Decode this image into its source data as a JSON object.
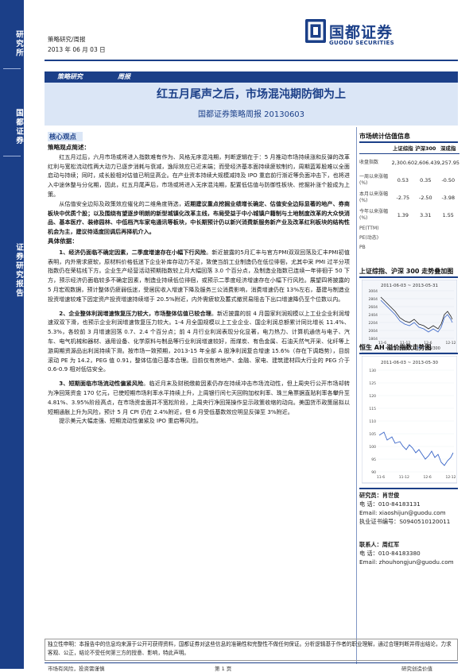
{
  "sidebar": {
    "labels": [
      "研究所",
      "国都证券",
      "证券研究报告"
    ]
  },
  "header": {
    "category": "策略研究/周报",
    "date": "2013 年 06 月 03 日",
    "logo_cn": "国都证券",
    "logo_en": "GUODU SECURITIES"
  },
  "tags": {
    "left": "策略研究",
    "right": "周报"
  },
  "title": "红五月尾声之后，市场混沌期防御为上",
  "subtitle": "国都证券策略周报 20130603",
  "core_label": "核心观点",
  "summary_heading": "策略观点简述：",
  "summary_para1": "红五月过后，六月市场或将进入指数难有作为、风格无序混沌期，判断逻辑在于：5 月推动市场持续涨和反弹的改革红利与宽松流动性两大动力已逐步消耗与衰减，逸际效应已近末端；而受经济基本面持续疲软制约，周期蓝筹股难以全面启动与持续；同时，成长股相对估值已明显高企。在产业资本持续大规模减持及 IPO 重启前行渐近等负面冲击下，也将进入中途休整与分化期，因此，红五月尾声后，市场或将进入无序混沌期，配置低估值与防御性板块、挖掘补涨个股成为上策。",
  "summary_para2": "从估值安全边际及政策效应催化的二维角度筛选，",
  "summary_para2_bold": "近期建议重点挖掘业绩增长确定、估值安全边际显著的地产、券商板块中优质个股；以及围绕有望逐步明朗的新型城镇化改革主线，布局受益于中小城镇户籍制与土地制度改革的大众快消品、基本医疗、装修园林、中低档汽车家电通讯等板块，中长期预计仍以新兴消费新服务新产业及改革红利板块的结构性机会为主，建议待适度回调后再择机介入。",
  "detail_heading": "具体依据：",
  "point1_bold": "1、经济仍面临不确定因素，二季度增速存在小幅下行风险",
  "point1_text": "。新近披露的5月汇丰与官方PMI双双回落及汇丰PMI初值表明，内外需求疲软，原材料价格低迷下企业补库存动力不足，致使当前工业制造仍在低位徘徊，尤其中采 PMI 过半分项指数仍在荣枯线下方。企业生产经营活动预期指数较上月大幅回落 3.0 个百分点，及制造业指数已连续一年徘徊于 50 下方，预示经济仍面临较多不确定因素，制造业持续低位徘徊，或预示二季度经济增速存在小幅下行风险。展望四将披露的 5 月宏观数据，预计整体仍疲弱低迷，受居民收入增速下降及服务三公消费影响，消费增速仍在 13%左右，基建与制造业投资增速较难下因定资产投资增速持续增于 20.5%附近，内外需疲软及蓄式撤贸易阻击下出口增速降仍至个位数以内。",
  "point2_bold": "2、企业整体利润增速恢复压力较大，市场整体估值已较合理",
  "point2_text": "。新近披露的前 4 月国家利润规模以上工业企业利润增速双双下滑，也预示企业利润增速恢复压力较大。1-4 月全国规模以上工业企业、国企利润总额累计同比增长 11.4%、5.3%，各较前 3 月增速回落 0.7、2.4 个百分点；前 4 月行业利润表现分化显著，电力热力、计算机通信与电子、汽车、电气机械和器材、通用设备、化学原料与制品等行业利润增速较好，而煤炭、有色金属、石油天然气开采、化纤等上游周期资源品出利润持续下滑。按市场一致预期，2013-15 年全部 A 股净利润复合增速 15.6%（存在下调趋势），目前滚动 PE 为 14.2，PEG 值 0.91，整体估值已基本合理。目前仅有房地产、金融、家电、建筑建材四大行业的 PEG 介于 0.6-0.9 相对低估安全。",
  "point3_bold": "3、短期面临市场流动性偏紧风险",
  "point3_text": "。临近月末及财税缴款因素仍存在持续冲击市场流动性，但上周央行公开市场却转为净回笼资金 170 亿元，已使短期市场利率水平持续上升，上周银行间七天回购加权利率、珠三角票据直贴利率各攀升至 4.81%、3.95%阶段高点，在市场资金面并不宽松阶段，上周央行净回笼操作显示政策收缩的动向。美国货币政策层拟以短期通胀上升为风险，预计 5 月 CPI 仍在 2.4%附近，但 6 月受低基数效应明显反弹至 3%附近。",
  "point3_tail": "提示美元大幅走强、短期流动性偏紧及 IPO 重启等风险。",
  "valuation": {
    "title": "市场统计估值信息",
    "columns": [
      "上证综指",
      "沪深300",
      "深成指"
    ],
    "rows": [
      {
        "label": "收盘指数",
        "values": [
          "2,300.60",
          "2,606.43",
          "9,257.95"
        ]
      },
      {
        "label": "一周以来涨幅(%)",
        "values": [
          "0.53",
          "0.35",
          "-0.50"
        ]
      },
      {
        "label": "本月以来涨幅(%)",
        "values": [
          "-2.75",
          "-2.50",
          "-3.98"
        ]
      },
      {
        "label": "今年以来涨幅(%)",
        "values": [
          "1.39",
          "3.31",
          "1.55"
        ]
      },
      {
        "label": "PE(TTM)",
        "values": [
          "",
          "",
          ""
        ]
      },
      {
        "label": "PE(动态)",
        "values": [
          "",
          "",
          ""
        ]
      },
      {
        "label": "PB",
        "values": [
          "",
          "",
          ""
        ]
      }
    ]
  },
  "chart1": {
    "title": "上证综指、沪深 300 走势叠加图",
    "date_range": "2011-06-03 ~ 2013-05-31",
    "y_ticks": [
      "3004",
      "2804",
      "2604",
      "2404",
      "2204",
      "2004",
      "1804"
    ],
    "x_ticks": [
      "11-6",
      "11-12",
      "12-6",
      "12-12"
    ],
    "legend": [
      "上证综指",
      "沪深300"
    ]
  },
  "chart2": {
    "title": "恒生 AH 溢价指数走势图",
    "date_range": "2011-06-03 ~ 2013-05-30",
    "y_ticks": [
      "130",
      "125",
      "120",
      "115",
      "110",
      "105",
      "100",
      "95",
      "90"
    ],
    "x_ticks": [
      "11-6",
      "11-12",
      "12-6",
      "12-12"
    ]
  },
  "analysts": [
    {
      "role": "研究员：",
      "name": "肖世俊",
      "phone_label": "电  话：",
      "phone": "010-84183131",
      "email_label": "Email:",
      "email": "xiaoshijun@guodu.com",
      "cert_label": "执业证书编号：",
      "cert": "S0940510120011"
    },
    {
      "role": "联系人：",
      "name": "周红军",
      "phone_label": "电  话：",
      "phone": "010-84183380",
      "email_label": "Email:",
      "email": "zhouhongjun@guodu.com"
    }
  ],
  "disclaimer": "独立性申明：本报告中的信息均来源于公开可获得资料，国都证券对这些信息的准确性和完整性不做任何保证。分析逻辑基于作者的职业理解，通过合理判断并得出结论，力求客观、公正，结论不受任何第三方的授意、影响，特此声明。",
  "footer": {
    "left": "市场有风险，投资需谨慎",
    "center": "第 1 页",
    "right": "研究创造价值"
  },
  "colors": {
    "brand": "#1b3f88",
    "band": "#dbe6f6",
    "series1": "#222222",
    "series2": "#3a66c8"
  }
}
